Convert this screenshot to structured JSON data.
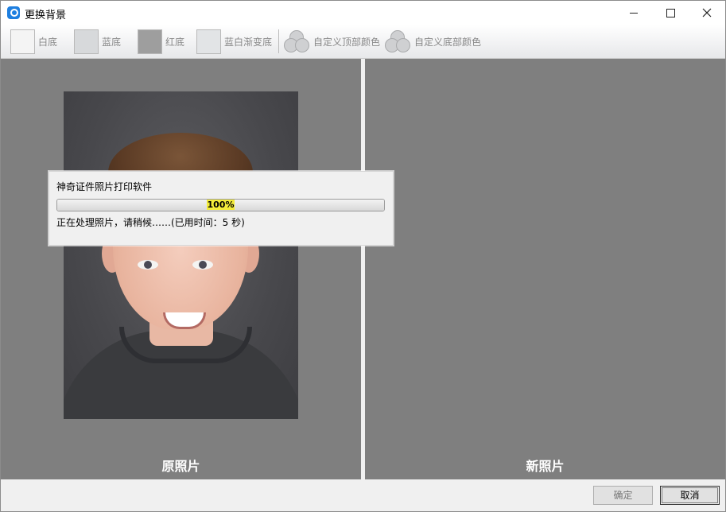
{
  "window": {
    "title": "更换背景",
    "icon": "app-logo-icon"
  },
  "toolbar": {
    "items": [
      {
        "label": "白底",
        "swatch_color": "#f4f4f4"
      },
      {
        "label": "蓝底",
        "swatch_color": "#d7d9db"
      },
      {
        "label": "红底",
        "swatch_color": "#9e9e9e"
      },
      {
        "label": "蓝白渐变底",
        "swatch_color": "#e2e4e6"
      }
    ],
    "custom_top_label": "自定义顶部颜色",
    "custom_bottom_label": "自定义底部颜色"
  },
  "panels": {
    "original_caption": "原照片",
    "new_caption": "新照片"
  },
  "dialog": {
    "title": "神奇证件照片打印软件",
    "progress_text": "100%",
    "progress_fraction": 1.0,
    "status": "正在处理照片，请稍候……(已用时间：5 秒)"
  },
  "buttons": {
    "ok": "确定",
    "cancel": "取消"
  },
  "colors": {
    "panel_bg": "#7f7f7f",
    "progress_highlight": "#f3ec3a"
  }
}
